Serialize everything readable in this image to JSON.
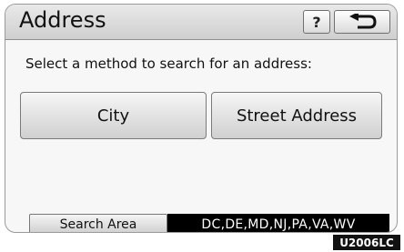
{
  "header": {
    "title": "Address",
    "help_label": "?",
    "back_icon": "return-arrow-icon"
  },
  "prompt": "Select a method to search for an address:",
  "methods": [
    {
      "label": "City"
    },
    {
      "label": "Street Address"
    }
  ],
  "search_area": {
    "button_label": "Search Area",
    "value": "DC,DE,MD,NJ,PA,VA,WV"
  },
  "figure_code": "U2006LC"
}
